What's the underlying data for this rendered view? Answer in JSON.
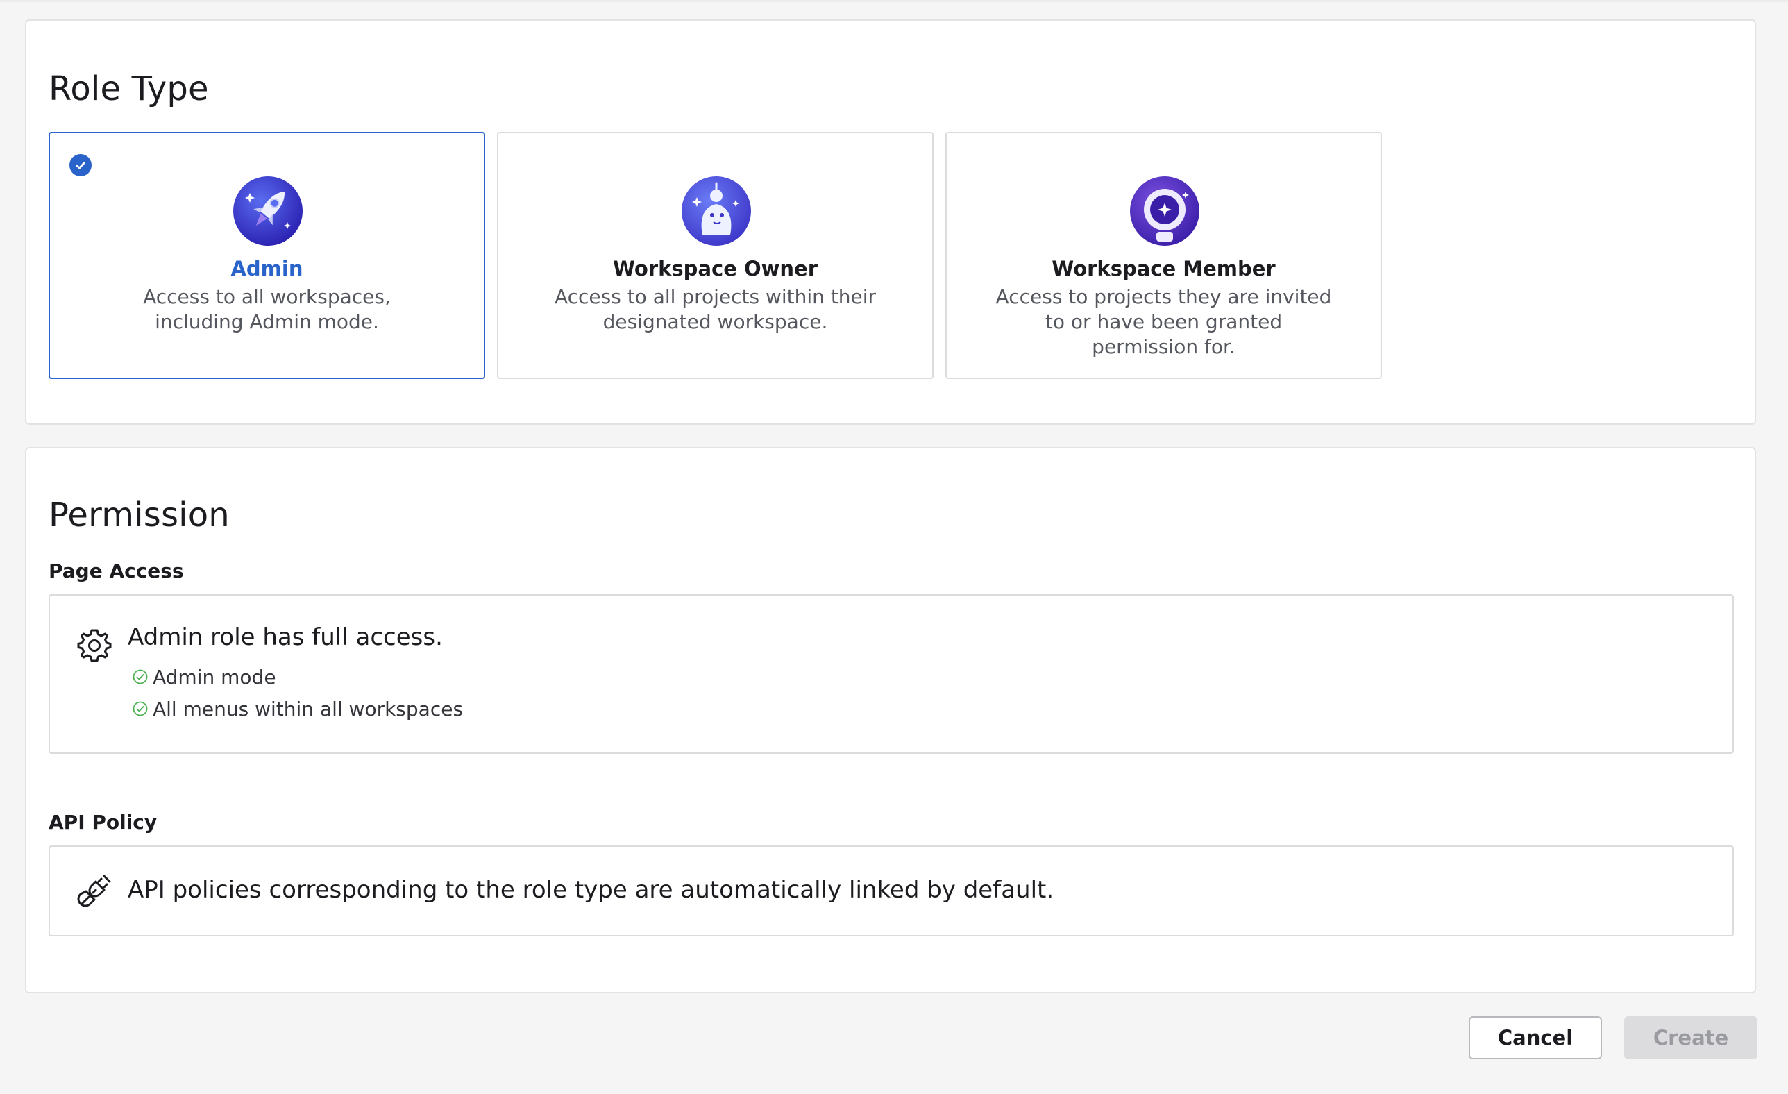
{
  "role_type": {
    "title": "Role Type",
    "cards": [
      {
        "name": "Admin",
        "description": "Access to all workspaces, including Admin mode.",
        "selected": true,
        "icon": "rocket-icon"
      },
      {
        "name": "Workspace Owner",
        "description": "Access to all projects within their designated workspace.",
        "selected": false,
        "icon": "owner-mascot-icon"
      },
      {
        "name": "Workspace Member",
        "description": "Access to projects they are invited to or have been granted permission for.",
        "selected": false,
        "icon": "astronaut-icon"
      }
    ]
  },
  "permission": {
    "title": "Permission",
    "page_access": {
      "label": "Page Access",
      "icon": "gear-icon",
      "summary": "Admin role has full access.",
      "items": [
        "Admin mode",
        "All menus within all workspaces"
      ]
    },
    "api_policy": {
      "label": "API Policy",
      "icon": "plug-link-icon",
      "summary": "API policies corresponding to the role type are automatically linked by default."
    }
  },
  "actions": {
    "cancel_label": "Cancel",
    "create_label": "Create"
  },
  "colors": {
    "accent": "#2a63c9",
    "success": "#4caf50",
    "disabled_bg": "#dcdcde"
  }
}
